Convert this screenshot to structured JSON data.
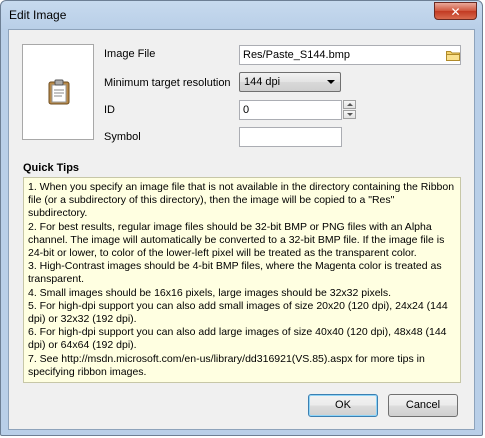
{
  "window": {
    "title": "Edit Image",
    "close_glyph": "✕"
  },
  "form": {
    "image_file_label": "Image File",
    "image_file_value": "Res/Paste_S144.bmp",
    "min_res_label": "Minimum target resolution",
    "min_res_value": "144 dpi",
    "id_label": "ID",
    "id_value": "0",
    "symbol_label": "Symbol",
    "symbol_value": ""
  },
  "tips": {
    "header": "Quick Tips",
    "items": [
      "1. When you specify an image file that is not available in the directory containing the Ribbon file (or a subdirectory of this directory), then the image will be copied to a \"Res\" subdirectory.",
      "2. For best results, regular image files should be 32-bit BMP or PNG files with an Alpha channel. The image will automatically be converted to a 32-bit BMP file. If the image file is 24-bit or lower, to color of the lower-left pixel will be treated as the transparent color.",
      "3. High-Contrast images should be 4-bit BMP files, where the Magenta color is treated as transparent.",
      "4. Small images should be 16x16 pixels, large images should be 32x32 pixels.",
      "5. For high-dpi support you can also add small images of size 20x20 (120 dpi), 24x24 (144 dpi) or 32x32 (192 dpi).",
      "6. For high-dpi support you can also add large images of size 40x40 (120 dpi), 48x48 (144 dpi) or 64x64 (192 dpi).",
      "7. See http://msdn.microsoft.com/en-us/library/dd316921(VS.85).aspx for more tips in specifying ribbon images."
    ]
  },
  "buttons": {
    "ok": "OK",
    "cancel": "Cancel"
  },
  "icons": {
    "preview": "clipboard-icon",
    "browse": "folder-icon"
  }
}
